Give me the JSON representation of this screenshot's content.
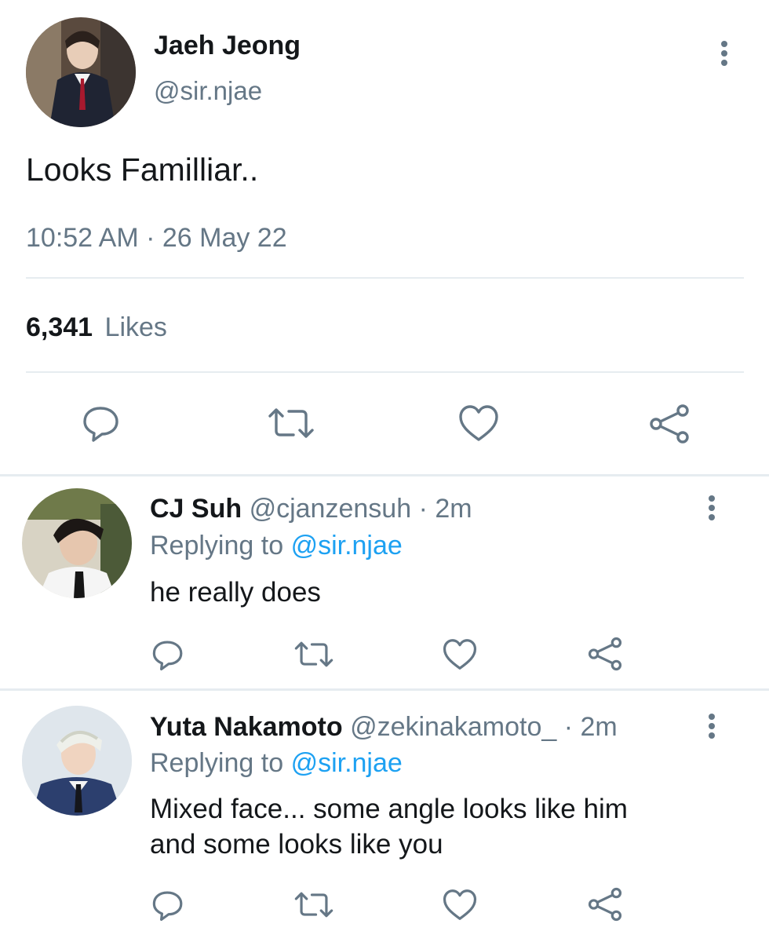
{
  "main_tweet": {
    "display_name": "Jaeh Jeong",
    "handle": "@sir.njae",
    "text": "Looks Familliar..",
    "timestamp": "10:52 AM · 26 May 22",
    "likes_count": "6,341",
    "likes_label": "Likes"
  },
  "replies": [
    {
      "display_name": "CJ Suh",
      "handle": "@cjanzensuh",
      "time": "· 2m",
      "replying_prefix": "Replying to",
      "replying_to": "@sir.njae",
      "text_lines": [
        "he really does"
      ]
    },
    {
      "display_name": "Yuta Nakamoto",
      "handle": "@zekinakamoto_",
      "time": "· 2m",
      "replying_prefix": "Replying to",
      "replying_to": "@sir.njae",
      "text_lines": [
        "Mixed face... some angle looks like him",
        "and some looks like you"
      ]
    }
  ],
  "icons": {
    "reply": "speech-bubble-icon",
    "retweet": "retweet-arrows-icon",
    "like": "heart-icon",
    "share": "share-nodes-icon",
    "more": "vertical-ellipsis-icon"
  },
  "colors": {
    "text": "#14171a",
    "muted": "#657786",
    "link": "#1da1f2",
    "divider": "#e6ecf0"
  }
}
